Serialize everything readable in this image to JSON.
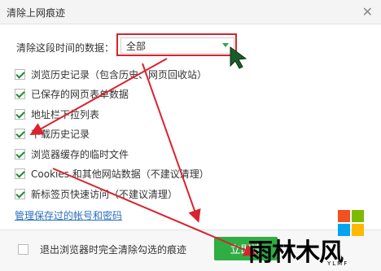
{
  "window": {
    "title": "清除上网痕迹"
  },
  "range": {
    "label": "清除这段时间的数据：",
    "selected": "全部"
  },
  "options": [
    {
      "label": "浏览历史记录（包含历史、网页回收站）",
      "checked": true
    },
    {
      "label": "已保存的网页表单数据",
      "checked": true
    },
    {
      "label": "地址栏下拉列表",
      "checked": true
    },
    {
      "label": "下载历史记录",
      "checked": true
    },
    {
      "label": "浏览器缓存的临时文件",
      "checked": true
    },
    {
      "label": "Cookies 和其他网站数据（不建议清理）",
      "checked": true
    },
    {
      "label": "新标签页快速访问（不建议清理）",
      "checked": true
    }
  ],
  "manage_link": "管理保存过的帐号和密码",
  "footer": {
    "exit_label": "退出浏览器时完全清除勾选的痕迹",
    "exit_checked": false,
    "clear_button": "立即清"
  },
  "watermark": {
    "text": "雨林木风",
    "sub": "YLMF"
  },
  "colors": {
    "accent_green": "#2fae44",
    "annotation_red": "#d9232f",
    "link_blue": "#2a6ebd"
  },
  "icons": {
    "close": "close-icon",
    "dropdown": "chevron-down-icon",
    "logo": "windows-logo-icon"
  }
}
